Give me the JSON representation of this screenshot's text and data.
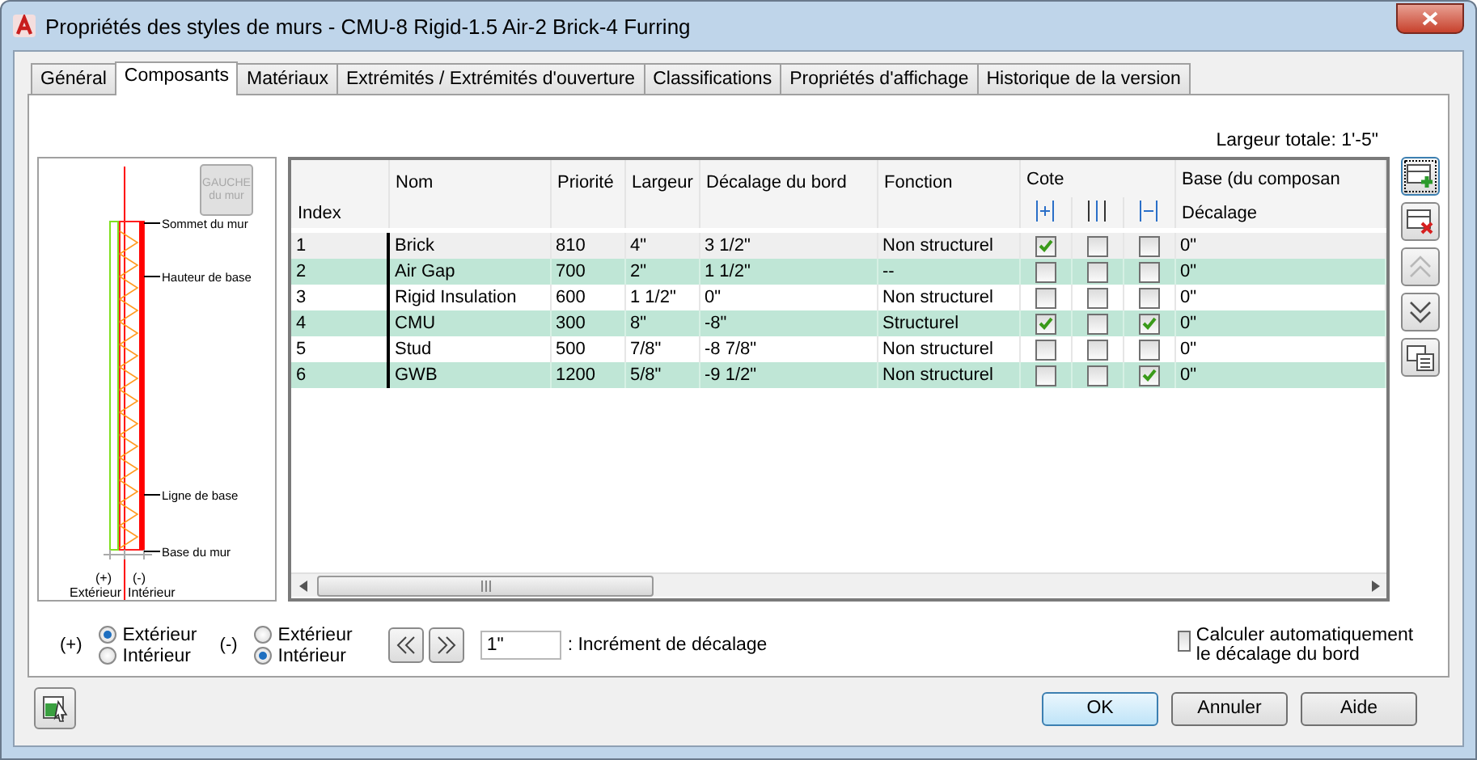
{
  "window": {
    "title": "Propriétés des styles de murs - CMU-8 Rigid-1.5 Air-2 Brick-4 Furring"
  },
  "tabs": [
    {
      "label": "Général",
      "selected": false
    },
    {
      "label": "Composants",
      "selected": true
    },
    {
      "label": "Matériaux",
      "selected": false
    },
    {
      "label": "Extrémités / Extrémités d'ouverture",
      "selected": false
    },
    {
      "label": "Classifications",
      "selected": false
    },
    {
      "label": "Propriétés d'affichage",
      "selected": false
    },
    {
      "label": "Historique de la version",
      "selected": false
    }
  ],
  "total_width": "Largeur totale: 1'-5\"",
  "preview": {
    "side_button": {
      "lines": [
        "GAUCHE",
        "du mur"
      ],
      "disabled": true
    },
    "labels": [
      "Sommet du mur",
      "Hauteur de base",
      "Ligne de base",
      "Base du mur"
    ],
    "sides": [
      {
        "sign": "(+)",
        "label": "Extérieur"
      },
      {
        "sign": "(-)",
        "label": "Intérieur"
      }
    ]
  },
  "table": {
    "columns": [
      "Index",
      "Nom",
      "Priorité",
      "Largeur",
      "Décalage du bord",
      "Fonction"
    ],
    "cote_group": "Cote",
    "base_group": "Base (du composan",
    "base_sub": "Décalage",
    "rows": [
      {
        "index": "1",
        "name": "Brick",
        "priority": "810",
        "width": "4\"",
        "edge_offset": "3 1/2\"",
        "function": "Non structurel",
        "cote": [
          {
            "checked": true
          },
          {
            "checked": false
          },
          {
            "checked": false
          }
        ],
        "base_offset": "0\"",
        "selected": true
      },
      {
        "index": "2",
        "name": "Air Gap",
        "priority": "700",
        "width": "2\"",
        "edge_offset": "1 1/2\"",
        "function": "--",
        "cote": [
          {
            "checked": false
          },
          {
            "checked": false
          },
          {
            "checked": false
          }
        ],
        "base_offset": "0\"",
        "selected": false
      },
      {
        "index": "3",
        "name": "Rigid Insulation",
        "priority": "600",
        "width": "1 1/2\"",
        "edge_offset": "0\"",
        "function": "Non structurel",
        "cote": [
          {
            "checked": false
          },
          {
            "checked": false
          },
          {
            "checked": false
          }
        ],
        "base_offset": "0\"",
        "selected": false
      },
      {
        "index": "4",
        "name": "CMU",
        "priority": "300",
        "width": "8\"",
        "edge_offset": "-8\"",
        "function": "Structurel",
        "cote": [
          {
            "checked": true
          },
          {
            "checked": false
          },
          {
            "checked": true
          }
        ],
        "base_offset": "0\"",
        "selected": false
      },
      {
        "index": "5",
        "name": "Stud",
        "priority": "500",
        "width": "7/8\"",
        "edge_offset": "-8 7/8\"",
        "function": "Non structurel",
        "cote": [
          {
            "checked": false
          },
          {
            "checked": false
          },
          {
            "checked": false
          }
        ],
        "base_offset": "0\"",
        "selected": false
      },
      {
        "index": "6",
        "name": "GWB",
        "priority": "1200",
        "width": "5/8\"",
        "edge_offset": "-9 1/2\"",
        "function": "Non structurel",
        "cote": [
          {
            "checked": false
          },
          {
            "checked": false
          },
          {
            "checked": true
          }
        ],
        "base_offset": "0\"",
        "selected": false
      }
    ]
  },
  "side_tools": [
    {
      "kind": "add",
      "disabled": false
    },
    {
      "kind": "delete",
      "disabled": false
    },
    {
      "kind": "up",
      "disabled": true
    },
    {
      "kind": "down",
      "disabled": false
    },
    {
      "kind": "copy",
      "disabled": false
    }
  ],
  "sides": [
    {
      "sign": "(+)",
      "options": [
        {
          "label": "Extérieur",
          "selected": true
        },
        {
          "label": "Intérieur",
          "selected": false
        }
      ]
    },
    {
      "sign": "(-)",
      "options": [
        {
          "label": "Extérieur",
          "selected": false
        },
        {
          "label": "Intérieur",
          "selected": true
        }
      ]
    }
  ],
  "offset_increment": {
    "value": "1\"",
    "label": ": Incrément de décalage"
  },
  "auto_offset": {
    "label": "Calculer automatiquement le décalage du bord",
    "checked": false
  },
  "buttons": [
    {
      "label": "OK",
      "default": true
    },
    {
      "label": "Annuler",
      "default": false
    },
    {
      "label": "Aide",
      "default": false
    }
  ]
}
